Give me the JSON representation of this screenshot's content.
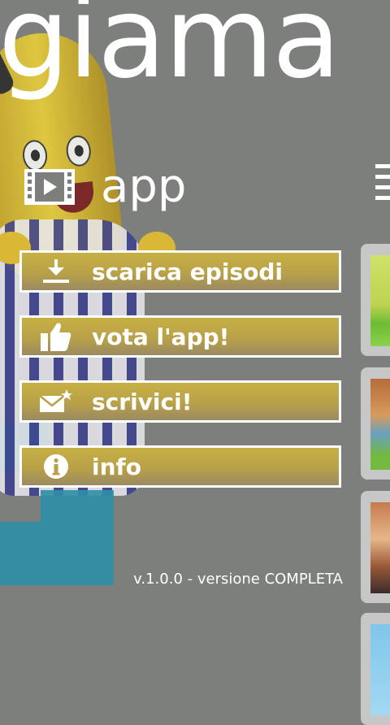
{
  "panorama": {
    "title": "giama"
  },
  "section": {
    "title": "app",
    "icon": "film-icon"
  },
  "menu": [
    {
      "label": "scarica episodi",
      "icon": "download-icon"
    },
    {
      "label": "vota l'app!",
      "icon": "thumbs-up-icon"
    },
    {
      "label": "scrivici!",
      "icon": "mail-icon"
    },
    {
      "label": "info",
      "icon": "info-icon"
    }
  ],
  "footer": {
    "version": "v.1.0.0 - versione COMPLETA"
  },
  "colors": {
    "background": "#7d7f7c",
    "button_fill": "#c7b043",
    "button_border": "#ffffff",
    "text": "#ffffff"
  }
}
